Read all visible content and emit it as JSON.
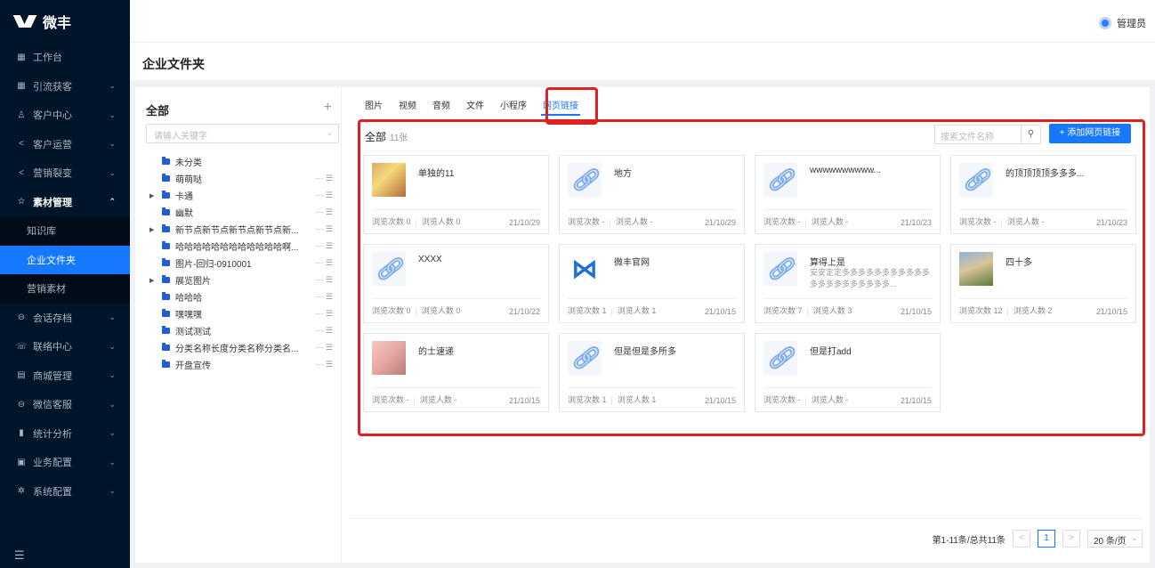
{
  "app": {
    "name": "微丰"
  },
  "sidebar": {
    "items": [
      {
        "label": "工作台",
        "icon": "grid-icon",
        "glyph": "▦",
        "chev": ""
      },
      {
        "label": "引流获客",
        "icon": "qrcode-icon",
        "glyph": "▦",
        "chev": "⌄"
      },
      {
        "label": "客户中心",
        "icon": "users-icon",
        "glyph": "♙",
        "chev": "⌄"
      },
      {
        "label": "客户运营",
        "icon": "share-icon",
        "glyph": "<",
        "chev": "⌄"
      },
      {
        "label": "营销裂变",
        "icon": "share-icon",
        "glyph": "<",
        "chev": "⌄"
      },
      {
        "label": "素材管理",
        "icon": "star-icon",
        "glyph": "☆",
        "chev": "⌃"
      }
    ],
    "sub_items": [
      "知识库",
      "企业文件夹",
      "营销素材"
    ],
    "items2": [
      {
        "label": "会话存档",
        "icon": "chat-icon",
        "glyph": "⊖",
        "chev": "⌄"
      },
      {
        "label": "联络中心",
        "icon": "phone-icon",
        "glyph": "☏",
        "chev": "⌄"
      },
      {
        "label": "商城管理",
        "icon": "shop-icon",
        "glyph": "▤",
        "chev": "⌄"
      },
      {
        "label": "微信客服",
        "icon": "service-icon",
        "glyph": "⊖",
        "chev": "⌄"
      },
      {
        "label": "统计分析",
        "icon": "chart-icon",
        "glyph": "▮",
        "chev": "⌄"
      },
      {
        "label": "业务配置",
        "icon": "config-icon",
        "glyph": "▣",
        "chev": "⌄"
      },
      {
        "label": "系统配置",
        "icon": "gear-icon",
        "glyph": "✲",
        "chev": "⌄"
      }
    ]
  },
  "header": {
    "user": "管理员",
    "page_title": "企业文件夹"
  },
  "left": {
    "title": "全部",
    "plus": "+",
    "search_placeholder": "请输入关键字",
    "tree": [
      {
        "name": "未分类",
        "arrow": "",
        "ops": ""
      },
      {
        "name": "萌萌哒",
        "arrow": "",
        "ops": "··· ☰"
      },
      {
        "name": "卡通",
        "arrow": "▶",
        "ops": "··· ☰"
      },
      {
        "name": "幽默",
        "arrow": "",
        "ops": "··· ☰"
      },
      {
        "name": "新节点新节点新节点新节点新...",
        "arrow": "▶",
        "ops": "··· ☰"
      },
      {
        "name": "哈哈哈哈哈哈哈哈哈哈哈哈啊...",
        "arrow": "",
        "ops": "··· ☰"
      },
      {
        "name": "图片-回归-0910001",
        "arrow": "",
        "ops": "··· ☰"
      },
      {
        "name": "展览图片",
        "arrow": "▶",
        "ops": "··· ☰"
      },
      {
        "name": "哈哈哈",
        "arrow": "",
        "ops": "··· ☰"
      },
      {
        "name": "嘿嘿嘿",
        "arrow": "",
        "ops": "··· ☰"
      },
      {
        "name": "测试测试",
        "arrow": "",
        "ops": "··· ☰"
      },
      {
        "name": "分类名称长度分类名称分类名...",
        "arrow": "",
        "ops": "··· ☰"
      },
      {
        "name": "开盘宣传",
        "arrow": "",
        "ops": "··· ☰"
      }
    ]
  },
  "tabs": [
    "图片",
    "视频",
    "音频",
    "文件",
    "小程序",
    "网页链接"
  ],
  "content": {
    "all_label": "全部",
    "count": "11张",
    "search_placeholder": "搜索文件名称",
    "add_button": "+ 添加网页链接",
    "cards": [
      {
        "name": "单独的11",
        "desc": "",
        "thumb": "photo",
        "views": "浏览次数 0",
        "visitors": "浏览人数 0",
        "date": "21/10/29"
      },
      {
        "name": "地方",
        "desc": "",
        "thumb": "link",
        "views": "浏览次数 -",
        "visitors": "浏览人数 -",
        "date": "21/10/29"
      },
      {
        "name": "wwwwwwwwww...",
        "desc": "",
        "thumb": "link",
        "views": "浏览次数 -",
        "visitors": "浏览人数 -",
        "date": "21/10/23"
      },
      {
        "name": "的顶顶顶顶多多多...",
        "desc": "",
        "thumb": "link",
        "views": "浏览次数 -",
        "visitors": "浏览人数 -",
        "date": "21/10/23"
      },
      {
        "name": "XXXX",
        "desc": "",
        "thumb": "link",
        "views": "浏览次数 0",
        "visitors": "浏览人数 0",
        "date": "21/10/22"
      },
      {
        "name": "微丰官网",
        "desc": "",
        "thumb": "logo2",
        "views": "浏览次数 1",
        "visitors": "浏览人数 1",
        "date": "21/10/15"
      },
      {
        "name": "算得上是",
        "desc": "安安定定多多多多多多多多多多多多多多多多多多多多多...",
        "thumb": "link",
        "views": "浏览次数 7",
        "visitors": "浏览人数 3",
        "date": "21/10/15"
      },
      {
        "name": "四十多",
        "desc": "",
        "thumb": "photo3",
        "views": "浏览次数 12",
        "visitors": "浏览人数 2",
        "date": "21/10/15"
      },
      {
        "name": "的士速递",
        "desc": "",
        "thumb": "photo2",
        "views": "浏览次数 -",
        "visitors": "浏览人数 -",
        "date": "21/10/15"
      },
      {
        "name": "但是但是多所多",
        "desc": "",
        "thumb": "link",
        "views": "浏览次数 1",
        "visitors": "浏览人数 1",
        "date": "21/10/15"
      },
      {
        "name": "但是打add",
        "desc": "",
        "thumb": "link",
        "views": "浏览次数 -",
        "visitors": "浏览人数 -",
        "date": "21/10/15"
      }
    ]
  },
  "pager": {
    "summary": "第1-11条/总共11条",
    "prev": "<",
    "current": "1",
    "next": ">",
    "size": "20 条/页"
  }
}
